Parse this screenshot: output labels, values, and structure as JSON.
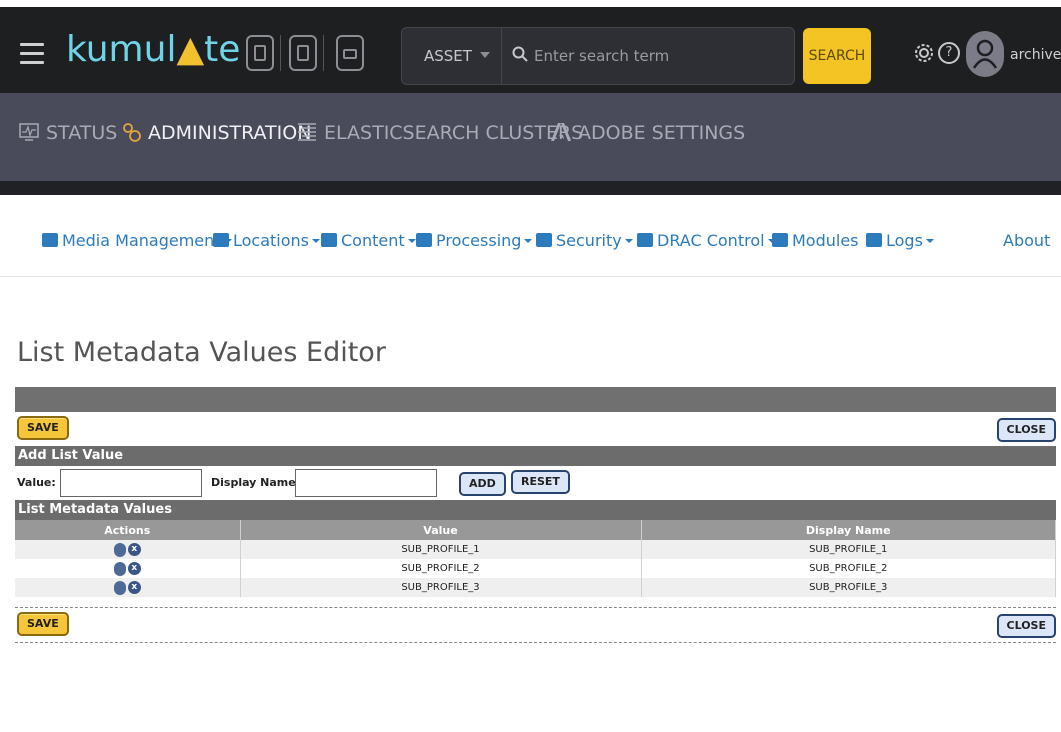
{
  "app": {
    "logo_text": "kumul",
    "logo_tri": "▲",
    "logo_suffix": "te",
    "search": {
      "scope": "ASSET",
      "placeholder": "Enter search term",
      "button": "SEARCH"
    },
    "help_label": "?",
    "username": "archiver"
  },
  "nav": {
    "items": [
      {
        "label": "STATUS",
        "icon": "monitor-icon",
        "active": false
      },
      {
        "label": "ADMINISTRATION",
        "icon": "gears-icon",
        "active": true
      },
      {
        "label": "ELASTICSEARCH CLUSTERS",
        "icon": "list-icon",
        "active": false
      },
      {
        "label": "ADOBE SETTINGS",
        "icon": "adobe-icon",
        "active": false
      }
    ]
  },
  "menu": {
    "items": [
      {
        "label": "Media Management",
        "icon": "monitor-icon",
        "dropdown": true
      },
      {
        "label": "Locations",
        "icon": "location-icon",
        "dropdown": true
      },
      {
        "label": "Content",
        "icon": "folder-icon",
        "dropdown": true
      },
      {
        "label": "Processing",
        "icon": "retweet-icon",
        "dropdown": true
      },
      {
        "label": "Security",
        "icon": "user-icon",
        "dropdown": true
      },
      {
        "label": "DRAC Control",
        "icon": "exchange-icon",
        "dropdown": true
      },
      {
        "label": "Modules",
        "icon": "check-icon",
        "dropdown": false
      },
      {
        "label": "Logs",
        "icon": "list-icon",
        "dropdown": true
      },
      {
        "label": "About",
        "icon": "",
        "dropdown": false
      }
    ]
  },
  "page": {
    "title": "List Metadata Values Editor"
  },
  "editor": {
    "save_label": "SAVE",
    "close_label": "CLOSE",
    "add_section": "Add List Value",
    "value_label": "Value:",
    "display_name_label": "Display Name:",
    "value_input": "",
    "display_name_input": "",
    "add_label": "ADD",
    "reset_label": "RESET",
    "list_section": "List Metadata Values",
    "columns": [
      "Actions",
      "Value",
      "Display Name"
    ],
    "rows": [
      {
        "value": "SUB_PROFILE_1",
        "display_name": "SUB_PROFILE_1"
      },
      {
        "value": "SUB_PROFILE_2",
        "display_name": "SUB_PROFILE_2"
      },
      {
        "value": "SUB_PROFILE_3",
        "display_name": "SUB_PROFILE_3"
      }
    ]
  },
  "colors": {
    "accent": "#f4c324",
    "brand": "#6fd4e8",
    "nav_bg": "#4a4b5a",
    "link": "#2c7bbd"
  }
}
